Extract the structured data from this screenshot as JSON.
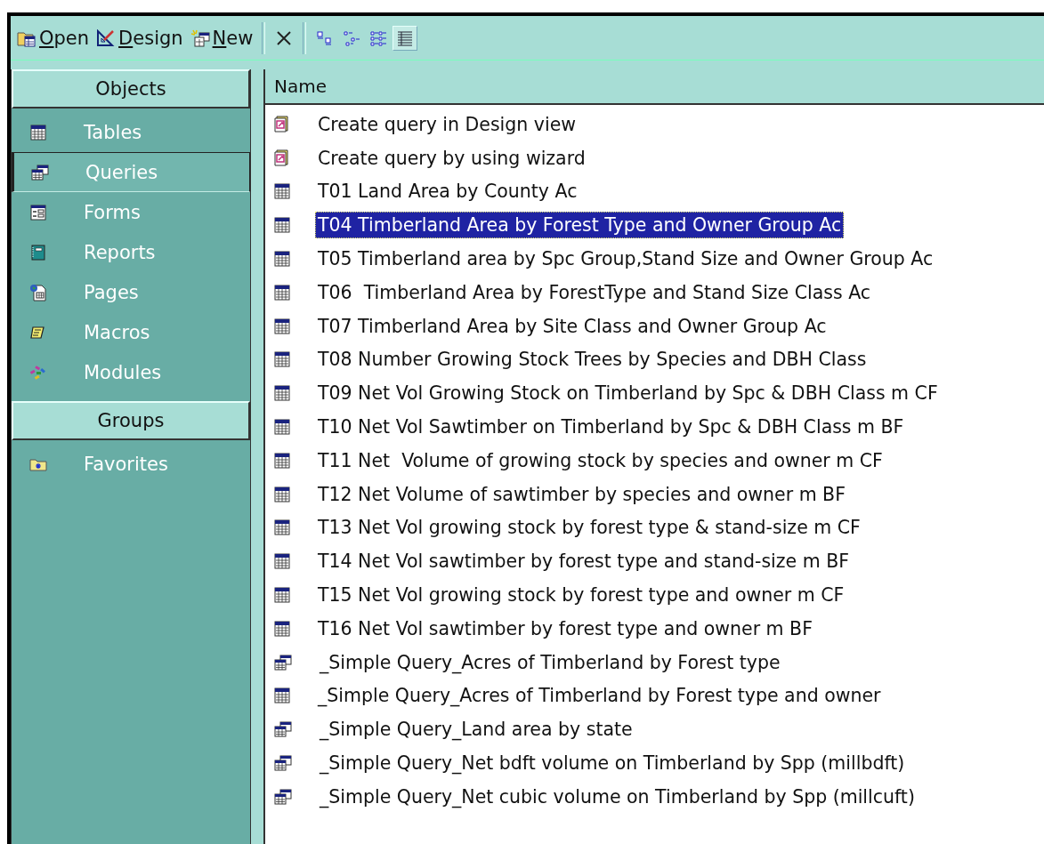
{
  "toolbar": {
    "buttons": [
      {
        "kind": "open",
        "label": "Open"
      },
      {
        "kind": "design",
        "label": "Design"
      },
      {
        "kind": "new",
        "label": "New"
      }
    ],
    "views": [
      {
        "kind": "large-icons",
        "selected": false
      },
      {
        "kind": "small-icons",
        "selected": false
      },
      {
        "kind": "list",
        "selected": false
      },
      {
        "kind": "details",
        "selected": true
      }
    ]
  },
  "sidebar": {
    "objects_header": "Objects",
    "items": [
      {
        "kind": "tables",
        "label": "Tables",
        "selected": false
      },
      {
        "kind": "queries",
        "label": "Queries",
        "selected": true
      },
      {
        "kind": "forms",
        "label": "Forms",
        "selected": false
      },
      {
        "kind": "reports",
        "label": "Reports",
        "selected": false
      },
      {
        "kind": "pages",
        "label": "Pages",
        "selected": false
      },
      {
        "kind": "macros",
        "label": "Macros",
        "selected": false
      },
      {
        "kind": "modules",
        "label": "Modules",
        "selected": false
      }
    ],
    "groups_header": "Groups",
    "groups": [
      {
        "kind": "favorites",
        "label": "Favorites",
        "selected": false
      }
    ]
  },
  "list": {
    "columns": [
      "Name"
    ],
    "rows": [
      {
        "kind": "wizard",
        "name": "Create query in Design view",
        "selected": false
      },
      {
        "kind": "wizard",
        "name": "Create query by using wizard",
        "selected": false
      },
      {
        "kind": "table",
        "name": "T01 Land Area by County Ac",
        "selected": false
      },
      {
        "kind": "table",
        "name": "T04 Timberland Area by Forest Type and Owner Group Ac",
        "selected": true
      },
      {
        "kind": "table",
        "name": "T05 Timberland area by Spc Group,Stand Size and Owner Group Ac",
        "selected": false
      },
      {
        "kind": "table",
        "name": "T06  Timberland Area by ForestType and Stand Size Class Ac",
        "selected": false
      },
      {
        "kind": "table",
        "name": "T07 Timberland Area by Site Class and Owner Group Ac",
        "selected": false
      },
      {
        "kind": "table",
        "name": "T08 Number Growing Stock Trees by Species and DBH Class",
        "selected": false
      },
      {
        "kind": "table",
        "name": "T09 Net Vol Growing Stock on Timberland by Spc & DBH Class m CF",
        "selected": false
      },
      {
        "kind": "table",
        "name": "T10 Net Vol Sawtimber on Timberland by Spc & DBH Class m BF",
        "selected": false
      },
      {
        "kind": "table",
        "name": "T11 Net  Volume of growing stock by species and owner m CF",
        "selected": false
      },
      {
        "kind": "table",
        "name": "T12 Net Volume of sawtimber by species and owner m BF",
        "selected": false
      },
      {
        "kind": "table",
        "name": "T13 Net Vol growing stock by forest type & stand-size m CF",
        "selected": false
      },
      {
        "kind": "table",
        "name": "T14 Net Vol sawtimber by forest type and stand-size m BF",
        "selected": false
      },
      {
        "kind": "table",
        "name": "T15 Net Vol growing stock by forest type and owner m CF",
        "selected": false
      },
      {
        "kind": "table",
        "name": "T16 Net Vol sawtimber by forest type and owner m BF",
        "selected": false
      },
      {
        "kind": "query",
        "name": "_Simple Query_Acres of Timberland by Forest type",
        "selected": false
      },
      {
        "kind": "table",
        "name": "_Simple Query_Acres of Timberland by Forest type and owner",
        "selected": false
      },
      {
        "kind": "query",
        "name": "_Simple Query_Land area by state",
        "selected": false
      },
      {
        "kind": "query",
        "name": "_Simple Query_Net bdft volume on Timberland by Spp (millbdft)",
        "selected": false
      },
      {
        "kind": "query",
        "name": "_Simple Query_Net cubic volume on Timberland by Spp (millcuft)",
        "selected": false
      }
    ]
  }
}
